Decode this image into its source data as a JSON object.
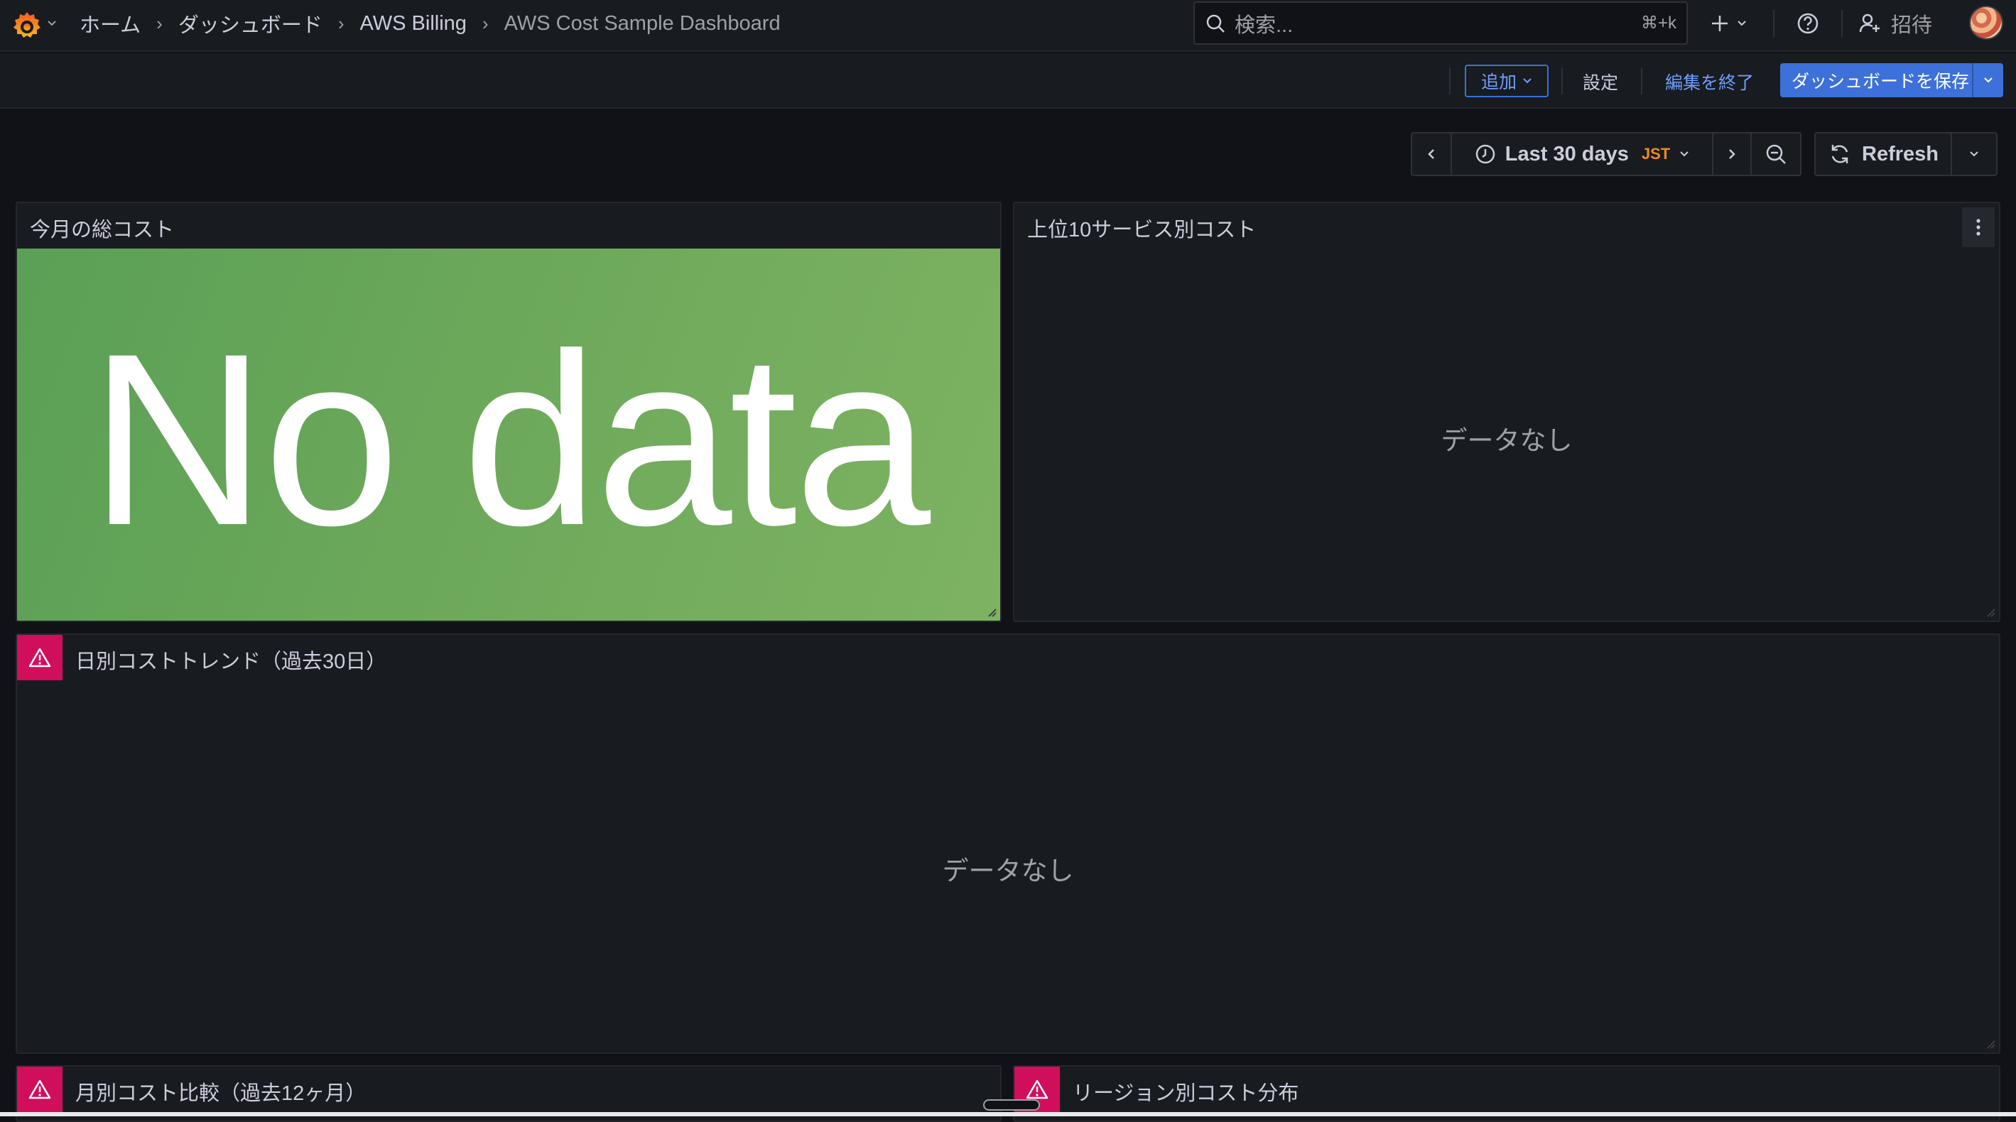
{
  "breadcrumb": [
    {
      "label": "ホーム"
    },
    {
      "label": "ダッシュボード"
    },
    {
      "label": "AWS Billing"
    },
    {
      "label": "AWS Cost Sample Dashboard"
    }
  ],
  "search": {
    "placeholder": "検索...",
    "shortcut": "⌘+k"
  },
  "invite_label": "招待",
  "toolbar": {
    "add_label": "追加",
    "settings_label": "設定",
    "exit_edit_label": "編集を終了",
    "save_label": "ダッシュボードを保存"
  },
  "time": {
    "range_label": "Last 30 days",
    "timezone": "JST",
    "refresh_label": "Refresh"
  },
  "panels": {
    "total_cost": {
      "title": "今月の総コスト",
      "value": "No data"
    },
    "top10": {
      "title": "上位10サービス別コスト",
      "empty": "データなし"
    },
    "daily_trend": {
      "title": "日別コストトレンド（過去30日）",
      "empty": "データなし"
    },
    "monthly": {
      "title": "月別コスト比較（過去12ヶ月）"
    },
    "region": {
      "title": "リージョン別コスト分布"
    }
  },
  "colors": {
    "accent": "#3d71d9",
    "stat_green": "#6ca85a",
    "alert": "#d10e5c",
    "timezone": "#f08a1f"
  }
}
